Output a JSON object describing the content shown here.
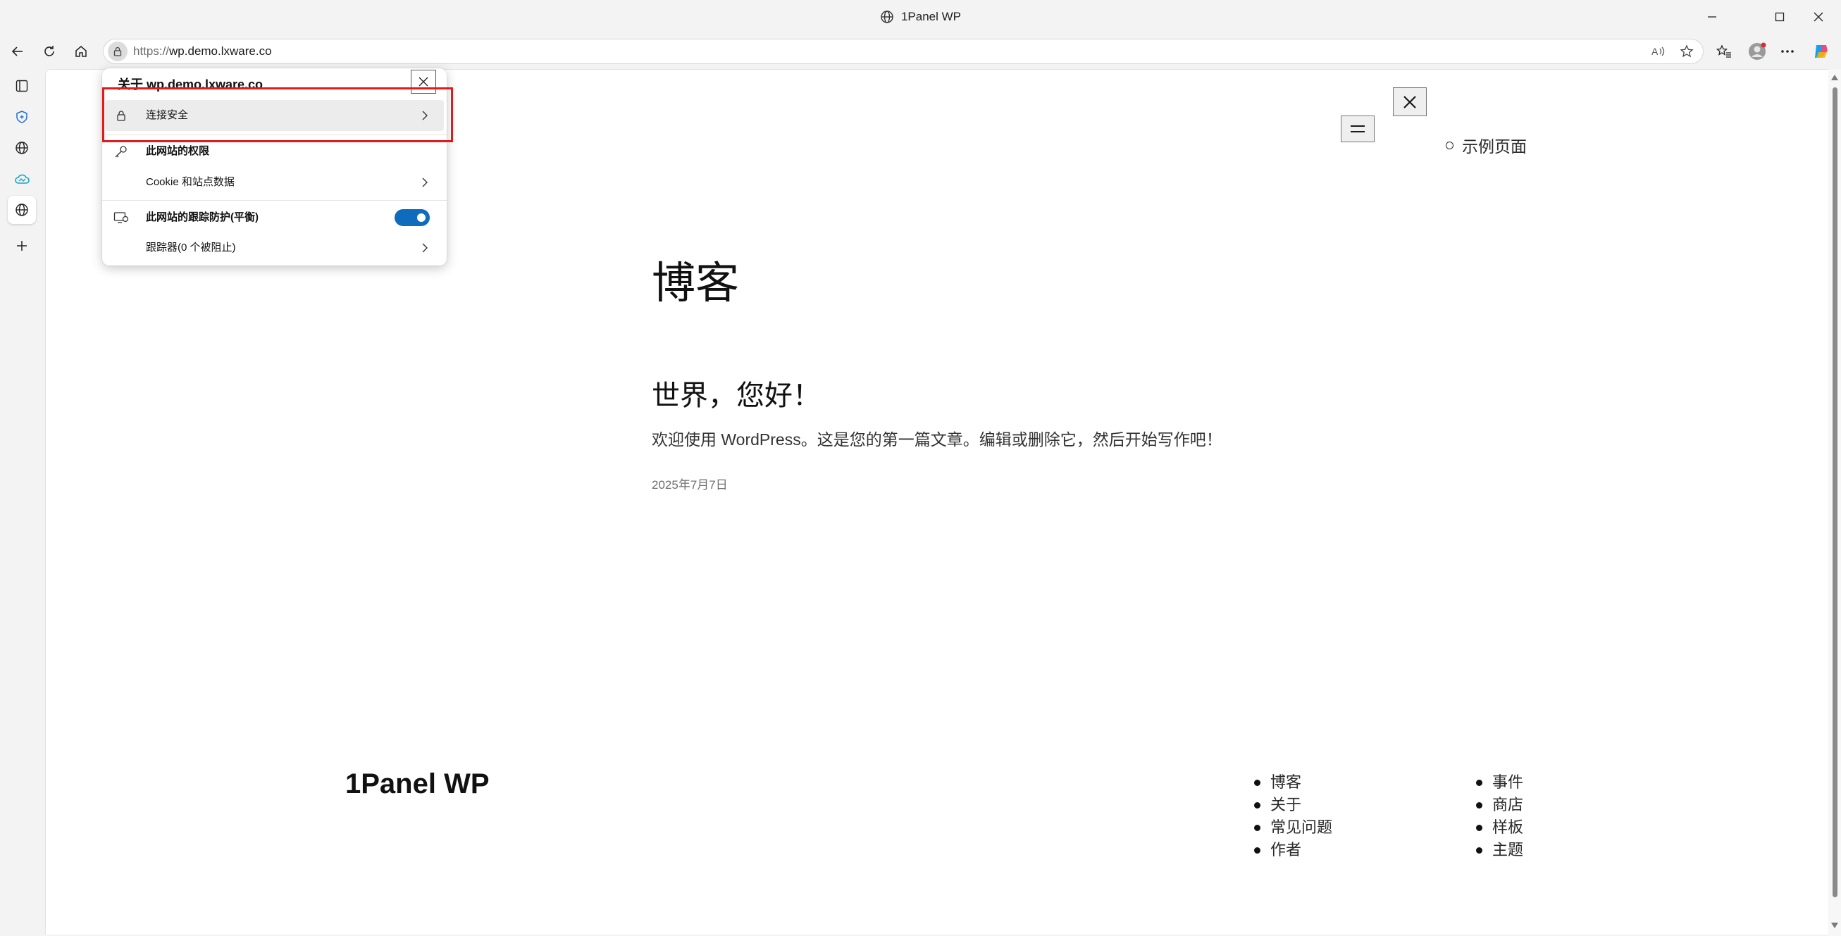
{
  "window": {
    "title": "1Panel WP",
    "title_icon": "globe-icon"
  },
  "toolbar": {
    "url_scheme": "https://",
    "url_host": "wp.demo.lxware.co"
  },
  "popup": {
    "title": "关于 wp.demo.lxware.co",
    "rows": {
      "connection": "连接安全",
      "permissions": "此网站的权限",
      "cookies": "Cookie 和站点数据",
      "tracking": "此网站的跟踪防护(平衡)",
      "trackers": "跟踪器(0 个被阻止)"
    },
    "tracking_enabled": true
  },
  "page": {
    "nav_item": "示例页面",
    "blog_title": "博客",
    "post": {
      "title": "世界，您好！",
      "excerpt": "欢迎使用 WordPress。这是您的第一篇文章。编辑或删除它，然后开始写作吧！",
      "date": "2025年7月7日"
    },
    "footer": {
      "site_name": "1Panel WP",
      "col1": [
        "博客",
        "关于",
        "常见问题",
        "作者"
      ],
      "col2": [
        "事件",
        "商店",
        "样板",
        "主题"
      ]
    }
  },
  "colors": {
    "accent": "#0f6cbd",
    "highlight": "#e01b1b"
  }
}
